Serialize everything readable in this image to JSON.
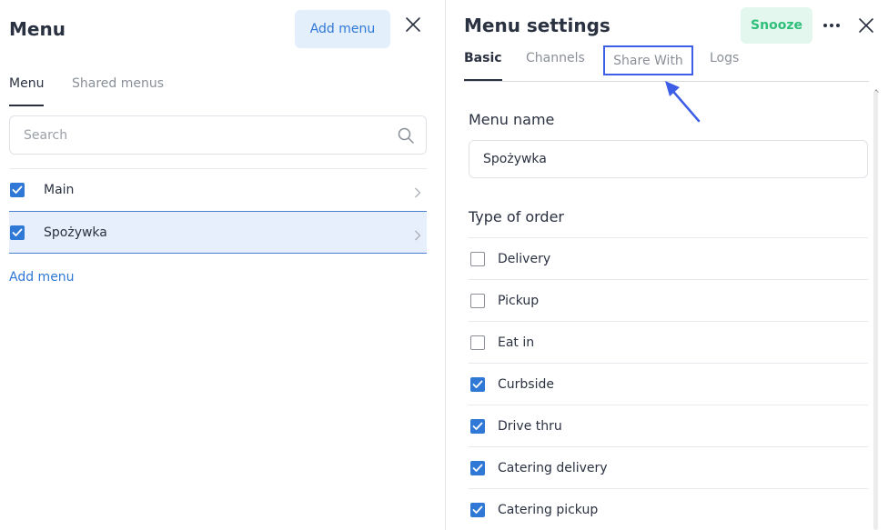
{
  "left_panel": {
    "title": "Menu",
    "add_menu_button": "Add menu",
    "tabs": [
      {
        "label": "Menu",
        "active": true
      },
      {
        "label": "Shared menus",
        "active": false
      }
    ],
    "search": {
      "placeholder": "Search",
      "value": ""
    },
    "menus": [
      {
        "label": "Main",
        "checked": true,
        "selected": false
      },
      {
        "label": "Spożywka",
        "checked": true,
        "selected": true
      }
    ],
    "add_menu_link": "Add menu"
  },
  "right_panel": {
    "title": "Menu settings",
    "snooze_button": "Snooze",
    "tabs": [
      {
        "label": "Basic",
        "active": true
      },
      {
        "label": "Channels",
        "active": false
      },
      {
        "label": "Share With",
        "active": false
      },
      {
        "label": "Logs",
        "active": false
      }
    ],
    "menu_name_label": "Menu name",
    "menu_name_value": "Spożywka",
    "type_of_order_label": "Type of order",
    "order_types": [
      {
        "label": "Delivery",
        "checked": false
      },
      {
        "label": "Pickup",
        "checked": false
      },
      {
        "label": "Eat in",
        "checked": false
      },
      {
        "label": "Curbside",
        "checked": true
      },
      {
        "label": "Drive thru",
        "checked": true
      },
      {
        "label": "Catering delivery",
        "checked": true
      },
      {
        "label": "Catering pickup",
        "checked": true
      }
    ]
  },
  "colors": {
    "accent": "#2f78d6",
    "snooze_text": "#2fbf7a",
    "snooze_bg": "#e3f7ee",
    "annotation": "#3d5ee6",
    "selected_row_bg": "#e7effc"
  },
  "icons": {
    "close": "close-icon",
    "search": "search-icon",
    "chevron": "chevron-right-icon",
    "more": "more-horizontal-icon",
    "check": "check-icon",
    "arrow": "annotation-arrow-icon"
  }
}
